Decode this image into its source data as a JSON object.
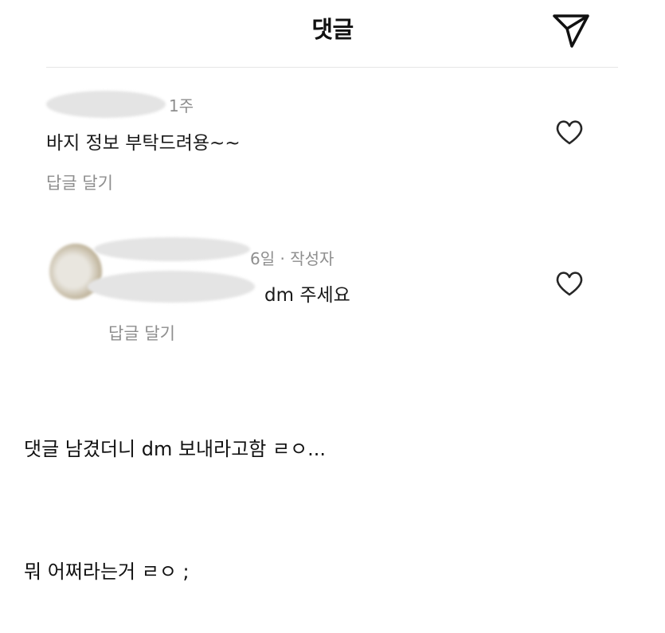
{
  "header": {
    "title": "댓글",
    "send_icon": "paper-plane-icon"
  },
  "comments": [
    {
      "time": "1주",
      "text": "바지 정보 부탁드려용~~",
      "reply_label": "답글 달기",
      "like_icon": "heart-icon"
    },
    {
      "time": "6일 · 작성자",
      "text": "dm 주세요",
      "reply_label": "답글 달기",
      "like_icon": "heart-icon"
    }
  ],
  "captions": [
    "댓글 남겼더니 dm 보내라고함 ㄹㅇ...",
    "뭐 어쩌라는거 ㄹㅇ ;"
  ]
}
